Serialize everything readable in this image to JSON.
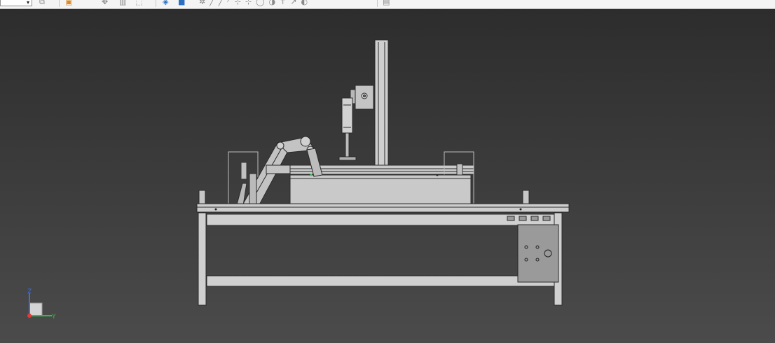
{
  "app": {
    "viewport_background": [
      "#2c2c2c",
      "#4b4b4b"
    ],
    "toolbar": {
      "view_dropdown": {
        "selected": ""
      },
      "buttons": [
        {
          "id": "display-style",
          "icon": "display-style-icon"
        },
        {
          "id": "appearance",
          "icon": "appearance-icon"
        },
        {
          "id": "pan",
          "icon": "pan-icon"
        },
        {
          "id": "section",
          "icon": "section-icon"
        },
        {
          "id": "select-box",
          "icon": "select-box-icon"
        },
        {
          "id": "view-orient",
          "icon": "view-cube-icon"
        },
        {
          "id": "shaded",
          "icon": "shaded-view-icon"
        },
        {
          "id": "sketch",
          "icon": "sketch-tools-icon"
        }
      ]
    }
  },
  "model": {
    "name": "",
    "frame_color": "#c8c8c8",
    "edge_color": "#2a2a2a",
    "panel_color": "#9a9a9a"
  },
  "triad": {
    "z_label": "Z",
    "y_label": "Y",
    "z_color": "#3a6ee8",
    "y_color": "#37b84a",
    "x_color": "#e03a3a"
  }
}
